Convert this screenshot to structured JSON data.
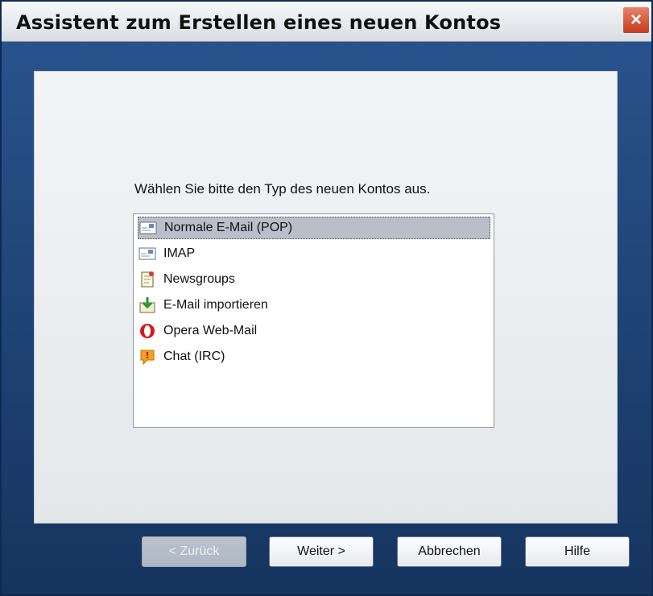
{
  "window": {
    "title": "Assistent zum Erstellen eines neuen Kontos",
    "close_label": "×"
  },
  "wizard": {
    "prompt": "Wählen Sie bitte den Typ des neuen Kontos aus.",
    "account_types": [
      {
        "label": "Normale E-Mail (POP)",
        "icon": "mail-icon",
        "selected": true
      },
      {
        "label": "IMAP",
        "icon": "mail-icon",
        "selected": false
      },
      {
        "label": "Newsgroups",
        "icon": "newsgroups-icon",
        "selected": false
      },
      {
        "label": "E-Mail importieren",
        "icon": "import-icon",
        "selected": false
      },
      {
        "label": "Opera Web-Mail",
        "icon": "opera-icon",
        "selected": false
      },
      {
        "label": "Chat (IRC)",
        "icon": "chat-icon",
        "selected": false
      }
    ]
  },
  "buttons": {
    "back": "< Zurück",
    "next": "Weiter >",
    "cancel": "Abbrechen",
    "help": "Hilfe"
  },
  "colors": {
    "window_background": "#1f3f75",
    "panel_background": "#eef1f4",
    "selected_item": "#b9bfc9",
    "close_button": "#d5492c"
  }
}
